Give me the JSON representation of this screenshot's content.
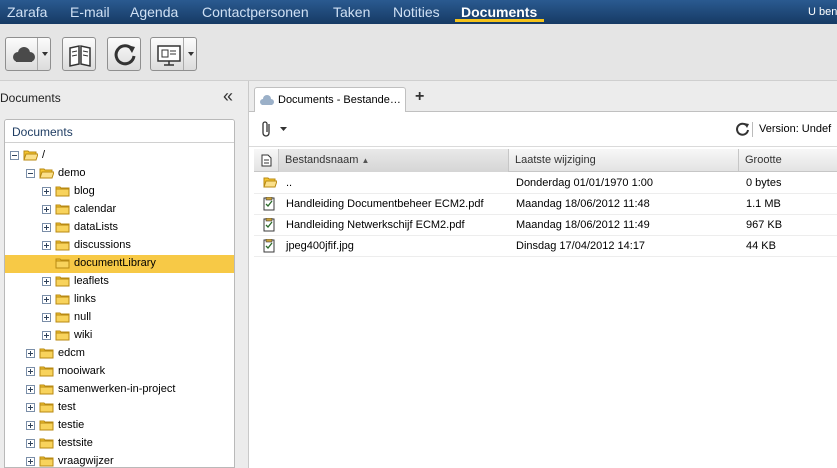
{
  "nav": {
    "tabs": [
      "Zarafa",
      "E-mail",
      "Agenda",
      "Contactpersonen",
      "Taken",
      "Notities",
      "Documents"
    ],
    "active_tab": "Documents",
    "user_label": "U ben"
  },
  "toolbar": {
    "buttons": [
      "cloud-menu-button",
      "address-book-button",
      "refresh-button",
      "presentation-menu-button"
    ]
  },
  "left": {
    "panel_title": "Documents",
    "tree_header": "Documents",
    "tree": [
      {
        "label": "/",
        "depth": 0,
        "toggle": "minus",
        "open": true
      },
      {
        "label": "demo",
        "depth": 1,
        "toggle": "minus",
        "open": true
      },
      {
        "label": "blog",
        "depth": 2,
        "toggle": "plus"
      },
      {
        "label": "calendar",
        "depth": 2,
        "toggle": "plus"
      },
      {
        "label": "dataLists",
        "depth": 2,
        "toggle": "plus"
      },
      {
        "label": "discussions",
        "depth": 2,
        "toggle": "plus"
      },
      {
        "label": "documentLibrary",
        "depth": 2,
        "toggle": "none",
        "selected": true
      },
      {
        "label": "leaflets",
        "depth": 2,
        "toggle": "plus"
      },
      {
        "label": "links",
        "depth": 2,
        "toggle": "plus"
      },
      {
        "label": "null",
        "depth": 2,
        "toggle": "plus"
      },
      {
        "label": "wiki",
        "depth": 2,
        "toggle": "plus"
      },
      {
        "label": "edcm",
        "depth": 1,
        "toggle": "plus"
      },
      {
        "label": "mooiwark",
        "depth": 1,
        "toggle": "plus"
      },
      {
        "label": "samenwerken-in-project",
        "depth": 1,
        "toggle": "plus"
      },
      {
        "label": "test",
        "depth": 1,
        "toggle": "plus"
      },
      {
        "label": "testie",
        "depth": 1,
        "toggle": "plus"
      },
      {
        "label": "testsite",
        "depth": 1,
        "toggle": "plus"
      },
      {
        "label": "vraagwijzer",
        "depth": 1,
        "toggle": "plus"
      }
    ]
  },
  "right": {
    "tab_label": "Documents - Bestande…",
    "version_label": "Version: Undef",
    "columns": [
      "Bestandsnaam",
      "Laatste wijziging",
      "Grootte"
    ],
    "sorted_column": "Bestandsnaam",
    "rows": [
      {
        "icon": "folder-up-icon",
        "name": "..",
        "modified": "Donderdag 01/01/1970 1:00",
        "size": "0 bytes"
      },
      {
        "icon": "file-icon",
        "name": "Handleiding Documentbeheer ECM2.pdf",
        "modified": "Maandag 18/06/2012 11:48",
        "size": "1.1 MB"
      },
      {
        "icon": "file-icon",
        "name": "Handleiding Netwerkschijf ECM2.pdf",
        "modified": "Maandag 18/06/2012 11:49",
        "size": "967 KB"
      },
      {
        "icon": "file-icon",
        "name": "jpeg400jfif.jpg",
        "modified": "Dinsdag 17/04/2012 14:17",
        "size": "44 KB"
      }
    ]
  },
  "colors": {
    "nav_bg": "#1a3f6b",
    "active_underline": "#f4c21a",
    "selection": "#f7c946",
    "folder": "#f5c530"
  }
}
